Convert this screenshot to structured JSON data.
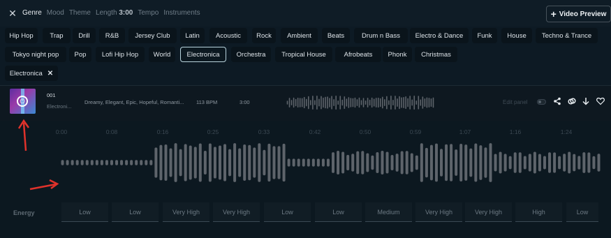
{
  "topbar": {
    "tabs": [
      {
        "label": "Genre",
        "active": true
      },
      {
        "label": "Mood",
        "active": false
      },
      {
        "label": "Theme",
        "active": false
      },
      {
        "label": "Length",
        "value": "3:00",
        "active": false
      },
      {
        "label": "Tempo",
        "active": false
      },
      {
        "label": "Instruments",
        "active": false
      }
    ],
    "video_preview_label": "Video Preview"
  },
  "genres": [
    "Hip Hop",
    "Trap",
    "Drill",
    "R&B",
    "Jersey Club",
    "Latin",
    "Acoustic",
    "Rock",
    "Ambient",
    "Beats",
    "Drum n Bass",
    "Electro & Dance",
    "Funk",
    "House",
    "Techno & Trance",
    "Tokyo night pop",
    "Pop",
    "Lofi Hip Hop",
    "World",
    "Electronica",
    "Orchestra",
    "Tropical House",
    "Afrobeats",
    "Phonk",
    "Christmas"
  ],
  "selected_genre": "Electronica",
  "applied_filter": "Electronica",
  "track": {
    "number": "001",
    "genre": "Electroni...",
    "moods": "Dreamy, Elegant, Epic, Hopeful, Romanti...",
    "bpm": "113 BPM",
    "duration": "3:00",
    "edit_panel_label": "Edit panel"
  },
  "timeline": [
    "0:00",
    "0:08",
    "0:16",
    "0:25",
    "0:33",
    "0:42",
    "0:50",
    "0:59",
    "1:07",
    "1:16",
    "1:24"
  ],
  "energy": {
    "label": "Energy",
    "levels": [
      "Low",
      "Low",
      "Very High",
      "Very High",
      "Low",
      "Low",
      "Medium",
      "Very High",
      "Very High",
      "High",
      "Low"
    ]
  },
  "colors": {
    "accent_arrow": "#e0322b",
    "wave": "#5e646b"
  }
}
